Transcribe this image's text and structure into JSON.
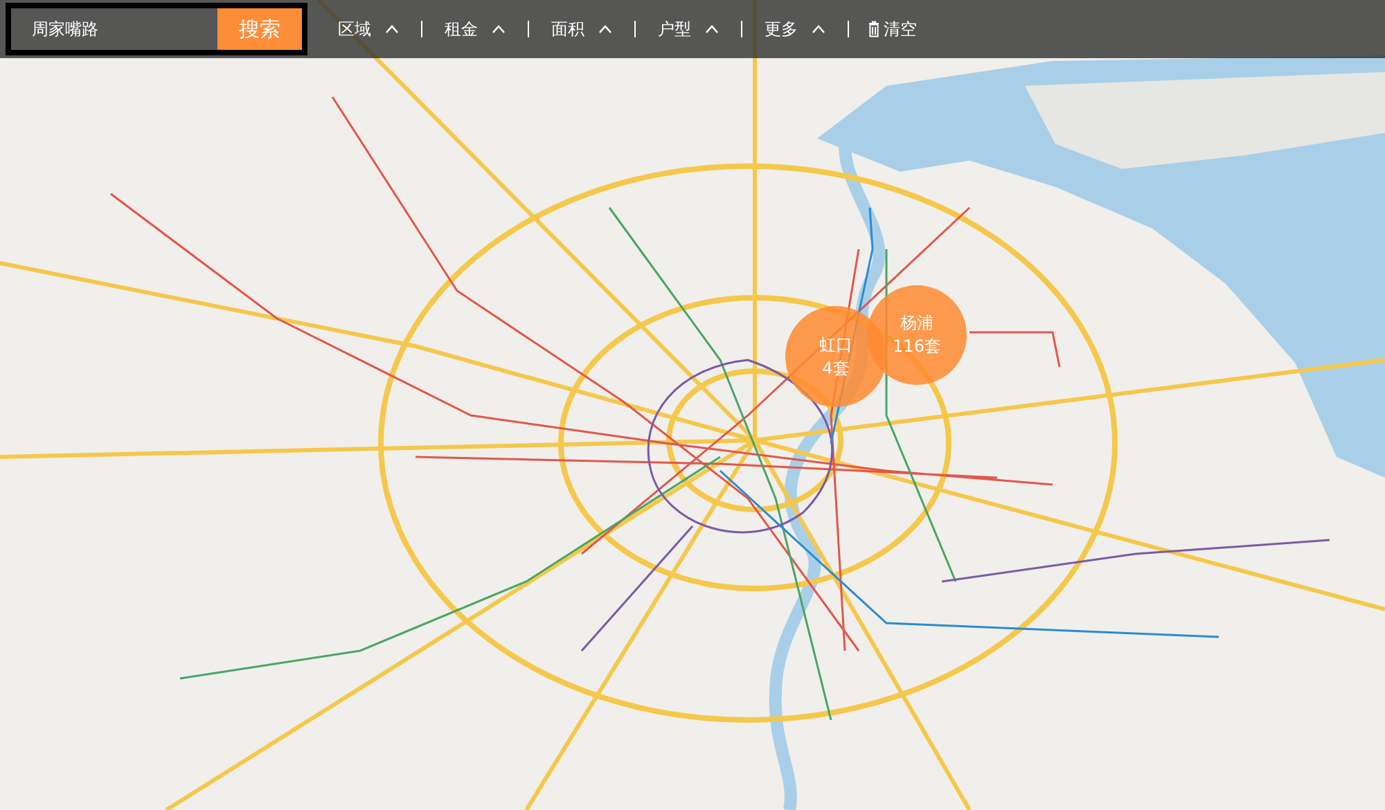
{
  "toolbar": {
    "search": {
      "value": "周家嘴路",
      "button": "搜索"
    },
    "filters": [
      {
        "label": "区域"
      },
      {
        "label": "租金"
      },
      {
        "label": "面积"
      },
      {
        "label": "户型"
      },
      {
        "label": "更多"
      }
    ],
    "clear_button": "清空"
  },
  "map": {
    "bubbles": [
      {
        "district": "虹口",
        "count": "4套"
      },
      {
        "district": "杨浦",
        "count": "116套"
      }
    ]
  }
}
